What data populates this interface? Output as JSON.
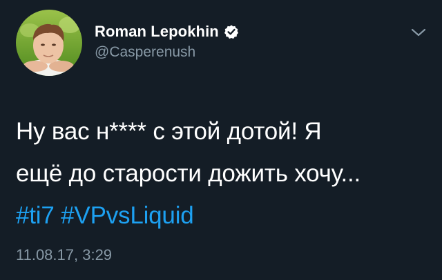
{
  "author": {
    "display_name": "Roman Lepokhin",
    "handle": "@Casperenush",
    "verified_icon": "verified-badge-icon"
  },
  "tweet": {
    "line1": "Ну вас н**** с этой дотой! Я",
    "line2": "ещё до старости дожить хочу...",
    "hashtags": [
      "#ti7",
      "#VPvsLiquid"
    ],
    "timestamp": "11.08.17, 3:29"
  },
  "menu": {
    "icon": "chevron-down-icon"
  },
  "colors": {
    "background": "#141d26",
    "text": "#ffffff",
    "secondary_text": "#8899a6",
    "link": "#1da1f2"
  }
}
